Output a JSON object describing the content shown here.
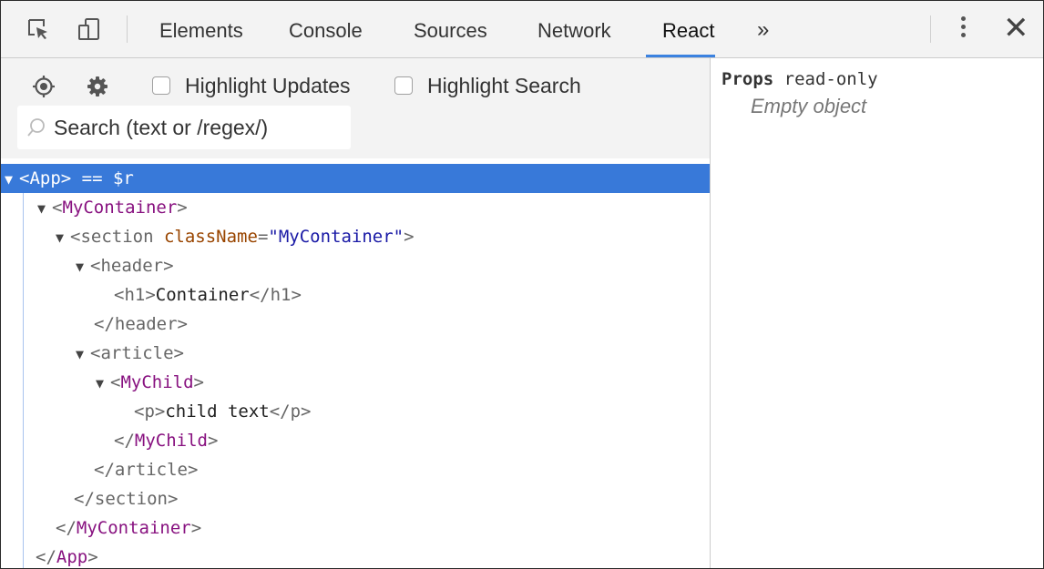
{
  "tabs": [
    {
      "label": "Elements"
    },
    {
      "label": "Console"
    },
    {
      "label": "Sources"
    },
    {
      "label": "Network"
    },
    {
      "label": "React",
      "active": true
    }
  ],
  "more_tabs": "»",
  "toolbar": {
    "highlight_updates_label": "Highlight Updates",
    "highlight_updates_checked": false,
    "highlight_search_label": "Highlight Search",
    "highlight_search_checked": false
  },
  "search": {
    "placeholder": "Search (text or /regex/)",
    "value": ""
  },
  "tree": {
    "app_open": "<App>",
    "app_suffix": " == $r",
    "mycontainer_open": "MyContainer",
    "section_tag": "section",
    "section_attr": "className",
    "section_attr_value": "\"MyContainer\"",
    "header_open": "<header>",
    "h1_line": "<h1>Container</h1>",
    "h1_open": "<h1>",
    "h1_text": "Container",
    "h1_close": "</h1>",
    "header_close": "</header>",
    "article_open": "<article>",
    "mychild_open": "MyChild",
    "p_open": "<p>",
    "p_text": "child text",
    "p_close": "</p>",
    "mychild_close": "MyChild",
    "article_close": "</article>",
    "section_close": "</section>",
    "mycontainer_close": "MyContainer",
    "app_close": "App"
  },
  "props": {
    "title_bold": "Props",
    "title_rest": " read-only",
    "empty_text": "Empty object"
  },
  "colors": {
    "selection": "#3879d9",
    "tab_active_underline": "#3b82e0",
    "component_tag": "#881280",
    "attribute": "#994500",
    "attribute_value": "#1a1aa6"
  }
}
